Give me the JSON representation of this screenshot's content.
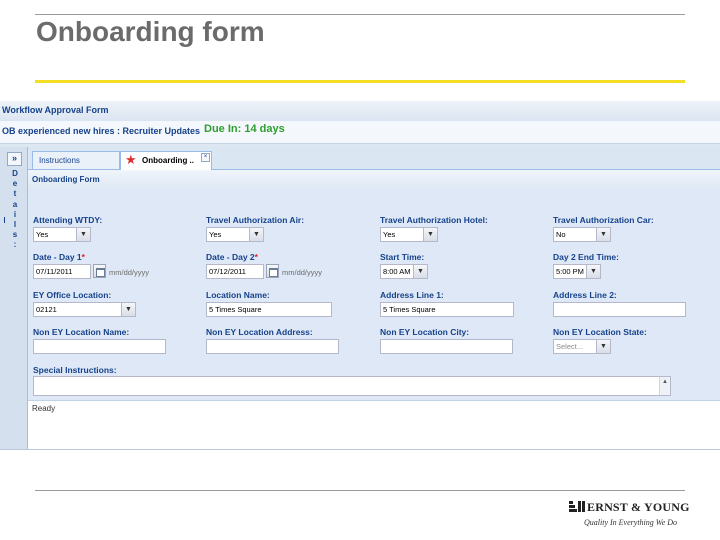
{
  "slide": {
    "title": "Onboarding form"
  },
  "window": {
    "title": "Workflow Approval Form",
    "subtitle": "OB experienced new hires : Recruiter Updates",
    "due": "Due In: 14 days"
  },
  "left_strip": {
    "collapse_glyph": "»",
    "letters": [
      "D",
      "e",
      "t",
      "a",
      "i",
      "l",
      "s",
      ":"
    ]
  },
  "tabs": [
    {
      "label": "Instructions",
      "active": false
    },
    {
      "label": "Onboarding ..",
      "active": true,
      "icon": "star-icon"
    }
  ],
  "panel": {
    "title": "Onboarding Form"
  },
  "fields": {
    "attending_wtdy": {
      "label": "Attending WTDY:",
      "value": "Yes"
    },
    "travel_air": {
      "label": "Travel Authorization Air:",
      "value": "Yes"
    },
    "travel_hotel": {
      "label": "Travel Authorization Hotel:",
      "value": "Yes"
    },
    "travel_car": {
      "label": "Travel Authorization Car:",
      "value": "No"
    },
    "date_day1": {
      "label": "Date - Day 1",
      "required": "*",
      "value": "07/11/2011",
      "hint": "mm/dd/yyyy"
    },
    "date_day2": {
      "label": "Date - Day 2",
      "required": "*",
      "value": "07/12/2011",
      "hint": "mm/dd/yyyy"
    },
    "start_time": {
      "label": "Start Time:",
      "value": "8:00 AM"
    },
    "day2_end_time": {
      "label": "Day 2 End Time:",
      "value": "5:00 PM"
    },
    "ey_office_location": {
      "label": "EY Office Location:",
      "value": "02121"
    },
    "location_name": {
      "label": "Location Name:",
      "value": "5 Times Square"
    },
    "address_line1": {
      "label": "Address Line 1:",
      "value": "5 Times Square"
    },
    "address_line2": {
      "label": "Address Line 2:",
      "value": ""
    },
    "non_ey_location_name": {
      "label": "Non EY Location Name:",
      "value": ""
    },
    "non_ey_location_address": {
      "label": "Non EY Location Address:",
      "value": ""
    },
    "non_ey_location_city": {
      "label": "Non EY Location City:",
      "value": ""
    },
    "non_ey_location_state": {
      "label": "Non EY Location State:",
      "value": "Select..."
    },
    "special_instructions": {
      "label": "Special Instructions:",
      "value": ""
    }
  },
  "status": {
    "text": "Ready"
  },
  "logo": {
    "name": "ERNST & YOUNG",
    "tagline": "Quality In Everything We Do"
  },
  "colors": {
    "accent_yellow": "#f3dd23",
    "label_blue": "#15428b",
    "due_green": "#2e9e2e",
    "required_red": "#e02020"
  }
}
